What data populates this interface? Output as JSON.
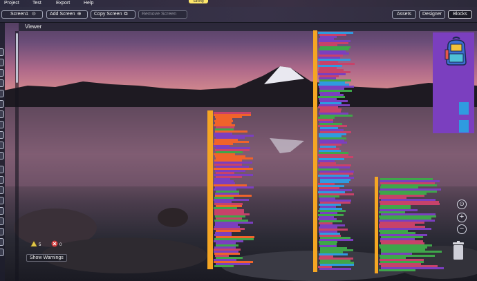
{
  "menu": {
    "items": [
      "Project",
      "Test",
      "Export",
      "Help"
    ],
    "saving_badge": "Saving"
  },
  "toolbar": {
    "screen_select": "Screen1",
    "add_screen": "Add Screen",
    "copy_screen": "Copy Screen",
    "remove_screen": "Remove Screen",
    "assets": "Assets",
    "designer": "Designer",
    "blocks": "Blocks"
  },
  "viewer": {
    "label": "Viewer"
  },
  "warnings": {
    "warning_count": "5",
    "error_count": "0",
    "show_warnings": "Show Warnings"
  },
  "zoom": {
    "recenter": "⊙",
    "zoom_in": "+",
    "zoom_out": "−"
  },
  "icons": {
    "screen_dropdown": "screen-dropdown-icon",
    "add": "add-icon",
    "copy": "copy-icon",
    "warning": "warning-icon",
    "error": "error-icon",
    "trash": "trash-icon",
    "backpack": "backpack-icon"
  },
  "colors": {
    "event_block": "#f5a623",
    "procedure_block": "#7b3fbf",
    "logic_block": "#3fa64a",
    "math_block": "#f0632b",
    "text_block": "#c7426a",
    "component_block": "#2f9be0",
    "saving_badge": "#ffe76a"
  }
}
